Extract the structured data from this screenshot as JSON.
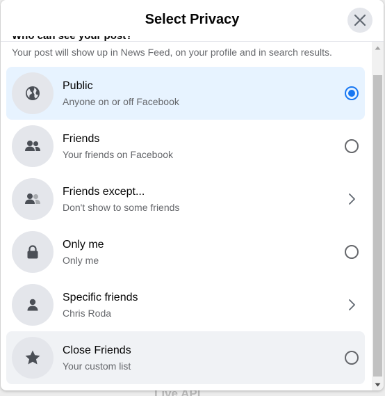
{
  "dialog": {
    "title": "Select Privacy",
    "subtitle_partial": "Who can see your post?",
    "description": "Your post will show up in News Feed, on your profile and in search results."
  },
  "options": [
    {
      "title": "Public",
      "subtitle": "Anyone on or off Facebook",
      "icon": "globe-icon",
      "control": "radio",
      "checked": true
    },
    {
      "title": "Friends",
      "subtitle": "Your friends on Facebook",
      "icon": "friends-icon",
      "control": "radio",
      "checked": false
    },
    {
      "title": "Friends except...",
      "subtitle": "Don't show to some friends",
      "icon": "friends-except-icon",
      "control": "chevron",
      "checked": false
    },
    {
      "title": "Only me",
      "subtitle": "Only me",
      "icon": "lock-icon",
      "control": "radio",
      "checked": false
    },
    {
      "title": "Specific friends",
      "subtitle": "Chris Roda",
      "icon": "person-icon",
      "control": "chevron",
      "checked": false
    },
    {
      "title": "Close Friends",
      "subtitle": "Your custom list",
      "icon": "star-icon",
      "control": "radio",
      "checked": false
    }
  ],
  "background": {
    "partial_text": "Live API"
  },
  "colors": {
    "accent": "#1877f2",
    "selected_bg": "#e7f3ff",
    "hover_bg": "#f0f2f5",
    "icon_bg": "#e4e6eb"
  }
}
